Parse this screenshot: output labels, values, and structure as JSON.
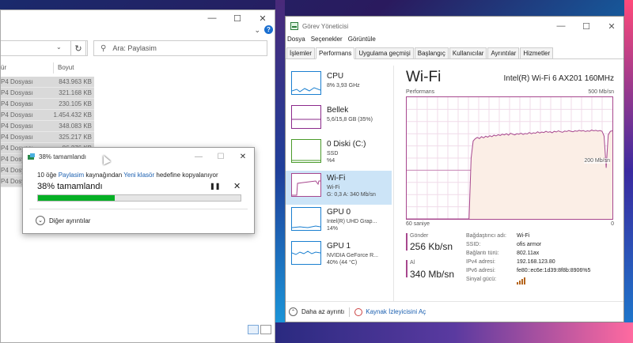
{
  "explorer": {
    "search_placeholder": "Ara: Paylasim",
    "col_type": "ür",
    "col_size": "Boyut",
    "rows": [
      {
        "type": "P4 Dosyası",
        "size": "843.963 KB"
      },
      {
        "type": "P4 Dosyası",
        "size": "321.168 KB"
      },
      {
        "type": "P4 Dosyası",
        "size": "230.105 KB"
      },
      {
        "type": "P4 Dosyası",
        "size": "1.454.432 KB"
      },
      {
        "type": "P4 Dosyası",
        "size": "348.083 KB"
      },
      {
        "type": "P4 Dosyası",
        "size": "325.217 KB"
      },
      {
        "type": "P4 Dosyası",
        "size": "86.276 KB"
      },
      {
        "type": "P4 Dosyası",
        "size": ""
      },
      {
        "type": "P4 Dosyası",
        "size": ""
      },
      {
        "type": "P4 Dosyası",
        "size": ""
      }
    ]
  },
  "copy_dialog": {
    "title": "38% tamamlandı",
    "line_prefix": "10 öğe",
    "source": "Paylasim",
    "line_mid": "kaynağından",
    "destination": "Yeni klasör",
    "line_suffix": "hedefine kopyalanıyor",
    "percent_label": "38% tamamlandı",
    "progress": 0.38,
    "more_details": "Diğer ayrıntılar"
  },
  "taskmgr": {
    "title": "Görev Yöneticisi",
    "menu": [
      "Dosya",
      "Seçenekler",
      "Görüntüle"
    ],
    "tabs": [
      "İşlemler",
      "Performans",
      "Uygulama geçmişi",
      "Başlangıç",
      "Kullanıcılar",
      "Ayrıntılar",
      "Hizmetler"
    ],
    "active_tab": "Performans",
    "sidebar": [
      {
        "name": "CPU",
        "sub": "8% 3,93 GHz",
        "sub2": "",
        "color": "#1a7fd0"
      },
      {
        "name": "Bellek",
        "sub": "5,6/15,8 GB (35%)",
        "sub2": "",
        "color": "#8b2a8b"
      },
      {
        "name": "0 Diski (C:)",
        "sub": "SSD",
        "sub2": "%4",
        "color": "#4a9a2a"
      },
      {
        "name": "Wi-Fi",
        "sub": "Wi-Fi",
        "sub2": "G: 0,3 A: 340 Mb/sn",
        "color": "#a7478e"
      },
      {
        "name": "GPU 0",
        "sub": "Intel(R) UHD Grap...",
        "sub2": "14%",
        "color": "#1a7fd0"
      },
      {
        "name": "GPU 1",
        "sub": "NVIDIA GeForce R...",
        "sub2": "40% (44 °C)",
        "color": "#1a7fd0"
      }
    ],
    "main_title": "Wi-Fi",
    "adapter": "Intel(R) Wi-Fi 6 AX201 160MHz",
    "graph_label": "Performans",
    "graph_max": "500 Mb/sn",
    "graph_mid": "200 Mb/sn",
    "graph_time": "60 saniye",
    "graph_zero": "0",
    "send_label": "Gönder",
    "send_value": "256 Kb/sn",
    "recv_label": "Al",
    "recv_value": "340 Mb/sn",
    "props": [
      {
        "k": "Bağdaştırıcı adı:",
        "v": "Wi-Fi"
      },
      {
        "k": "SSID:",
        "v": "ofis armor"
      },
      {
        "k": "Bağlantı türü:",
        "v": "802.11ax"
      },
      {
        "k": "IPv4 adresi:",
        "v": "192.168.123.80"
      },
      {
        "k": "IPv6 adresi:",
        "v": "fe80::ec6e:1d39:8f8b:8906%5"
      },
      {
        "k": "Sinyal gücü:",
        "v": ""
      }
    ],
    "footer_less": "Daha az ayrıntı",
    "footer_monitor": "Kaynak İzleyicisini Aç",
    "graph_series_mbps": [
      0,
      0,
      0,
      0,
      0,
      0,
      0,
      0,
      0,
      0,
      0,
      0,
      0,
      0,
      0,
      0,
      0,
      0,
      0,
      0,
      0,
      0,
      0,
      0,
      0,
      0,
      0,
      0,
      0,
      0,
      0,
      250,
      320,
      330,
      335,
      330,
      338,
      333,
      340,
      336,
      342,
      338,
      344,
      341,
      346,
      343,
      348,
      345,
      350,
      344,
      352,
      348,
      345,
      350,
      348,
      352,
      347,
      351,
      349,
      355,
      350,
      354,
      352,
      358,
      353,
      357,
      355,
      360,
      356,
      358,
      354,
      360,
      357,
      362,
      358,
      356,
      361,
      359,
      363,
      360,
      358,
      362,
      360,
      364,
      361,
      363,
      359,
      362,
      360,
      365,
      362,
      364,
      361,
      363,
      360,
      340,
      210,
      345,
      360,
      362
    ]
  }
}
